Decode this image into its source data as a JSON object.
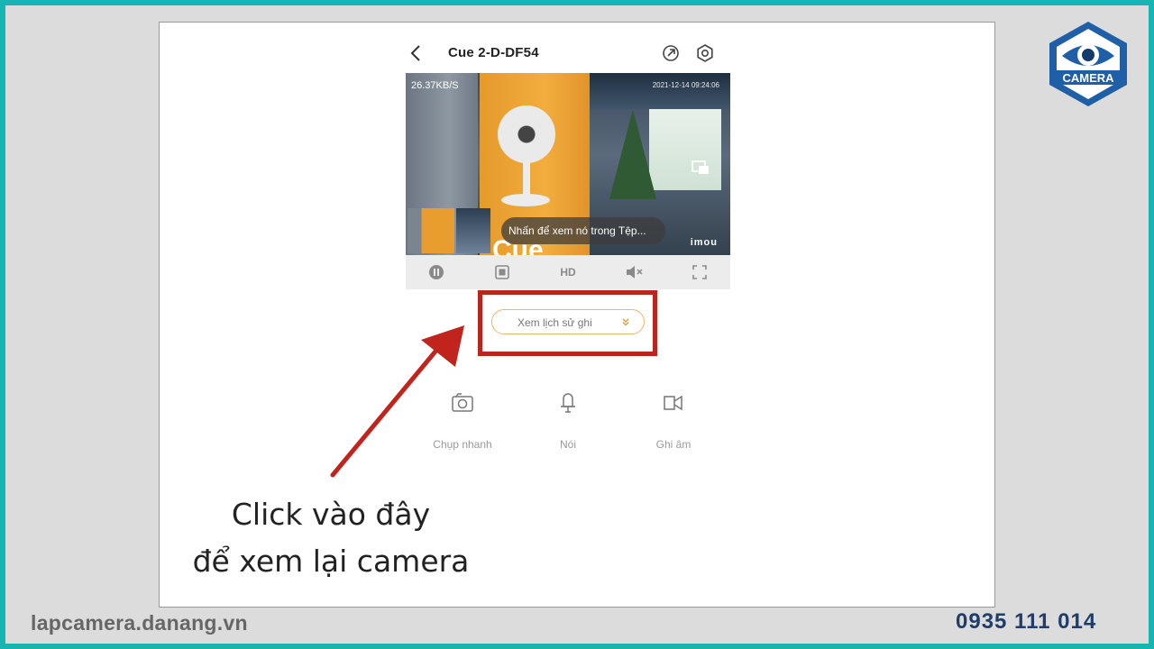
{
  "app": {
    "device_title": "Cue 2-D-DF54",
    "video": {
      "bitrate": "26.37KB/S",
      "timestamp": "2021-12-14 09:24:06",
      "box_text": "Cue",
      "toast": "Nhấn để xem nó trong Tệp...",
      "brand": "imou"
    },
    "controls": {
      "quality_label": "HD"
    },
    "history_button": "Xem lịch sử ghi",
    "actions": [
      {
        "label": "Chụp nhanh",
        "icon": "camera-icon"
      },
      {
        "label": "Nói",
        "icon": "microphone-icon"
      },
      {
        "label": "Ghi âm",
        "icon": "video-record-icon"
      }
    ]
  },
  "annotation": {
    "line1": "Click vào đây",
    "line2": "để xem lại camera",
    "highlight_color": "#b8261f"
  },
  "brand": {
    "logo_text": "CAMERA",
    "website": "lapcamera.danang.vn",
    "hotline": "0935 111 014",
    "frame_color": "#17b4b1"
  }
}
